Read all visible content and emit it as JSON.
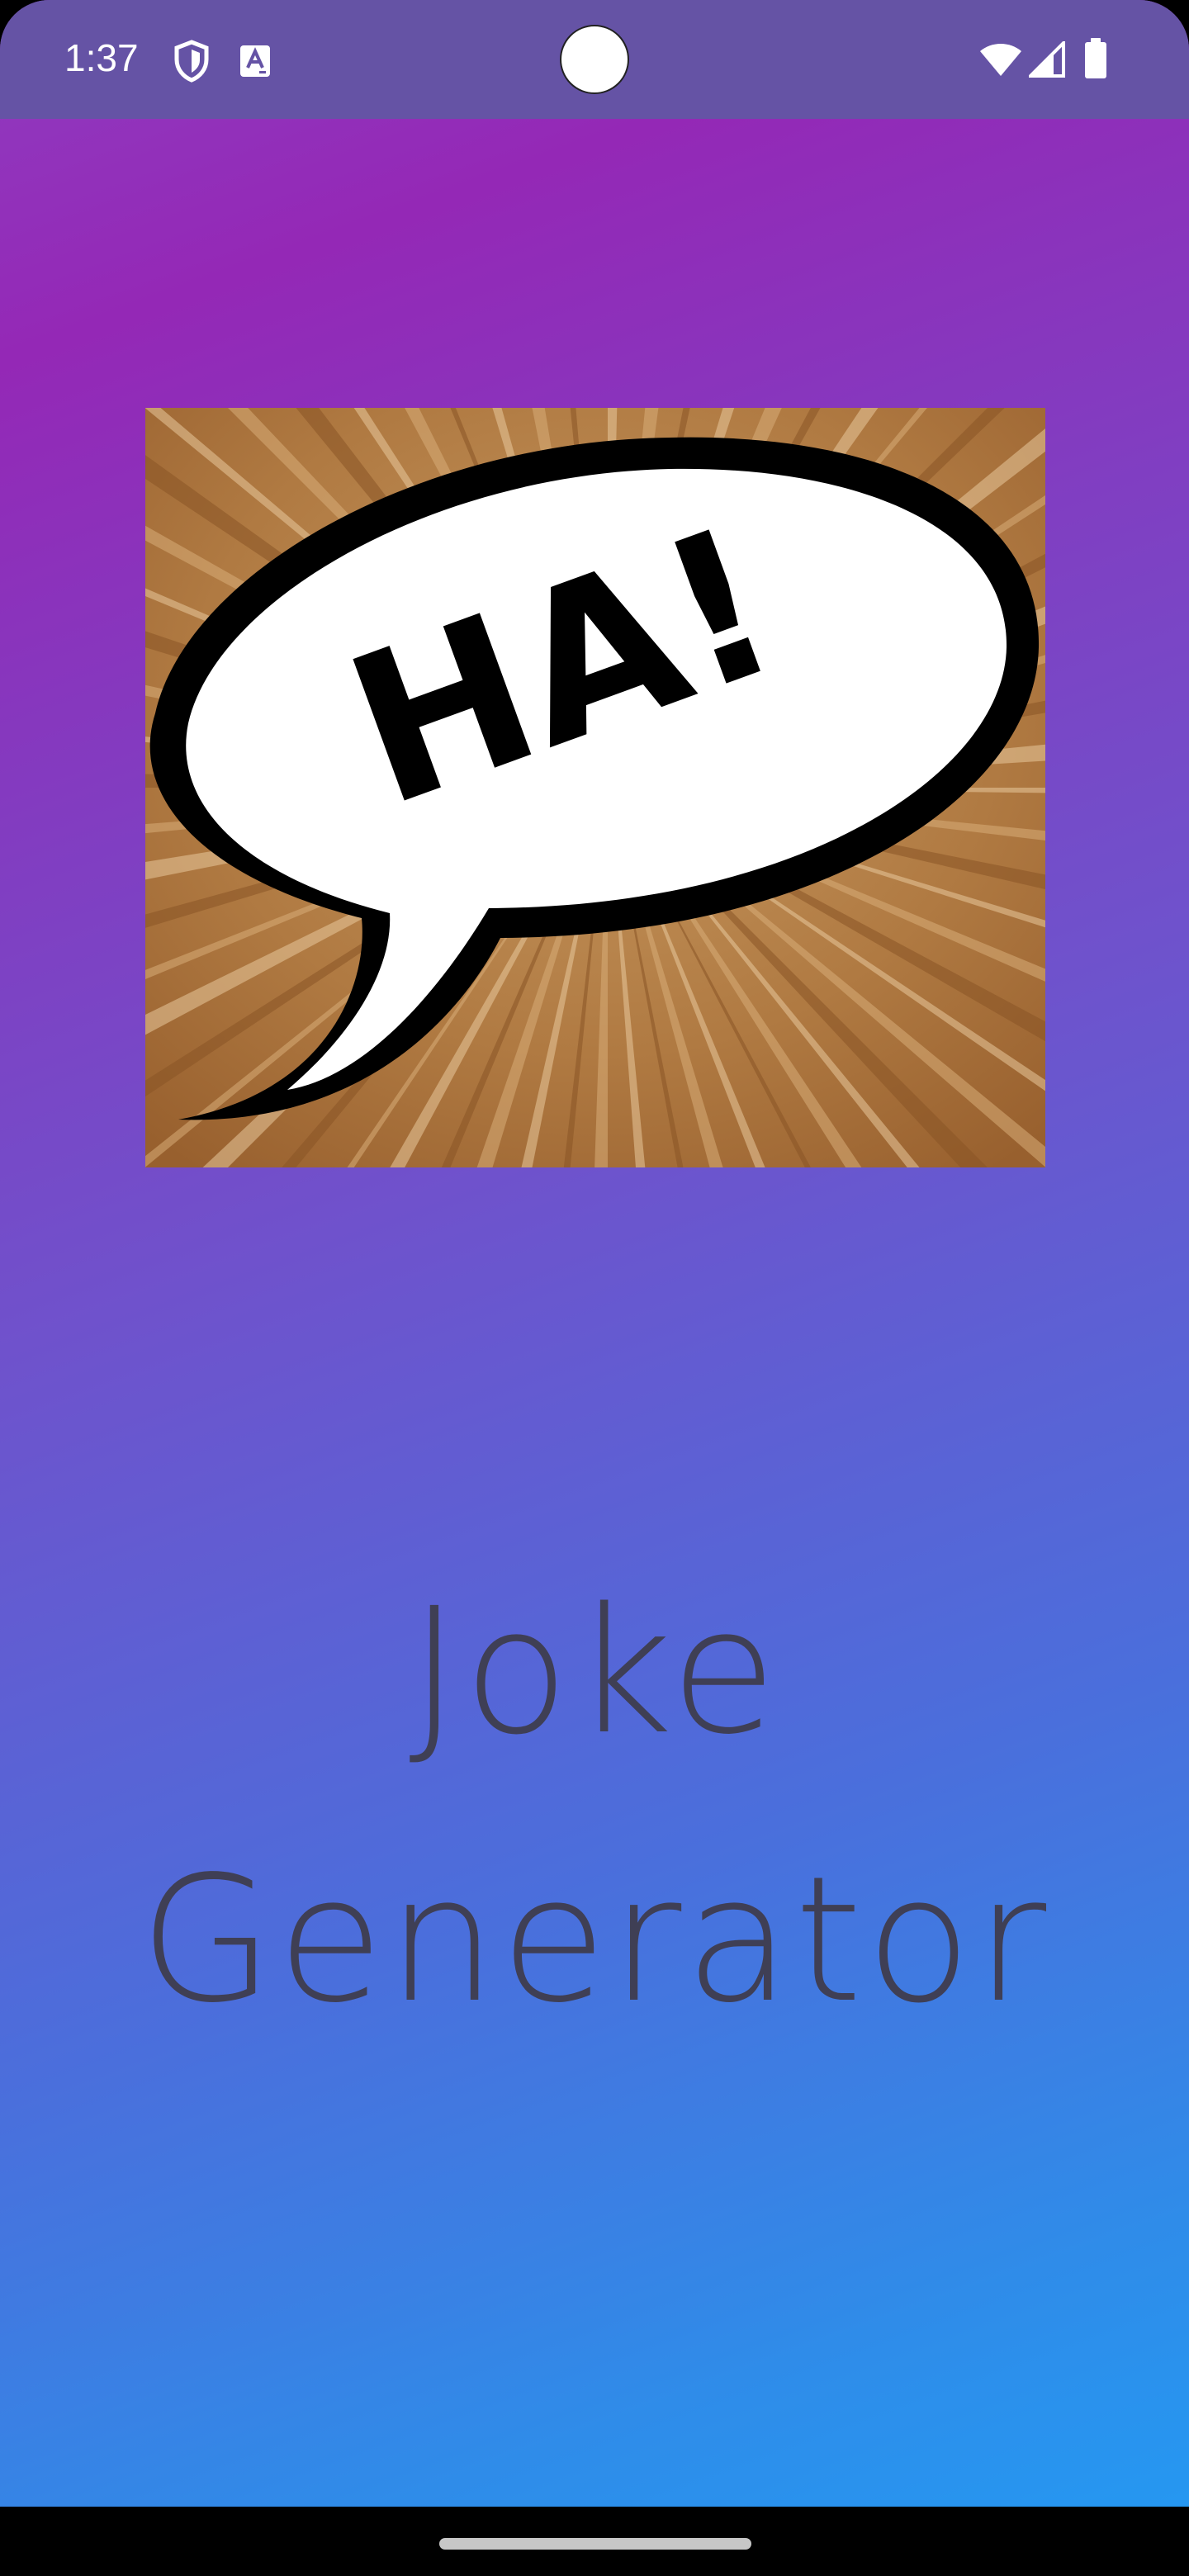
{
  "status_bar": {
    "time": "1:37",
    "left_icons": [
      "shield-icon",
      "font-a-icon"
    ],
    "right_icons": [
      "wifi-icon",
      "signal-icon",
      "battery-icon"
    ],
    "background": "#6553a5"
  },
  "hero_image": {
    "icon": "ha-speech-bubble-image",
    "bubble_text": "HA!"
  },
  "title": {
    "line1": "Joke",
    "line2": "Generator"
  },
  "colors": {
    "gradient_top": "#9428b6",
    "gradient_bottom": "#239af3",
    "title_text": "#3f3f55"
  },
  "nav_bar": {
    "handle": "home-handle"
  }
}
